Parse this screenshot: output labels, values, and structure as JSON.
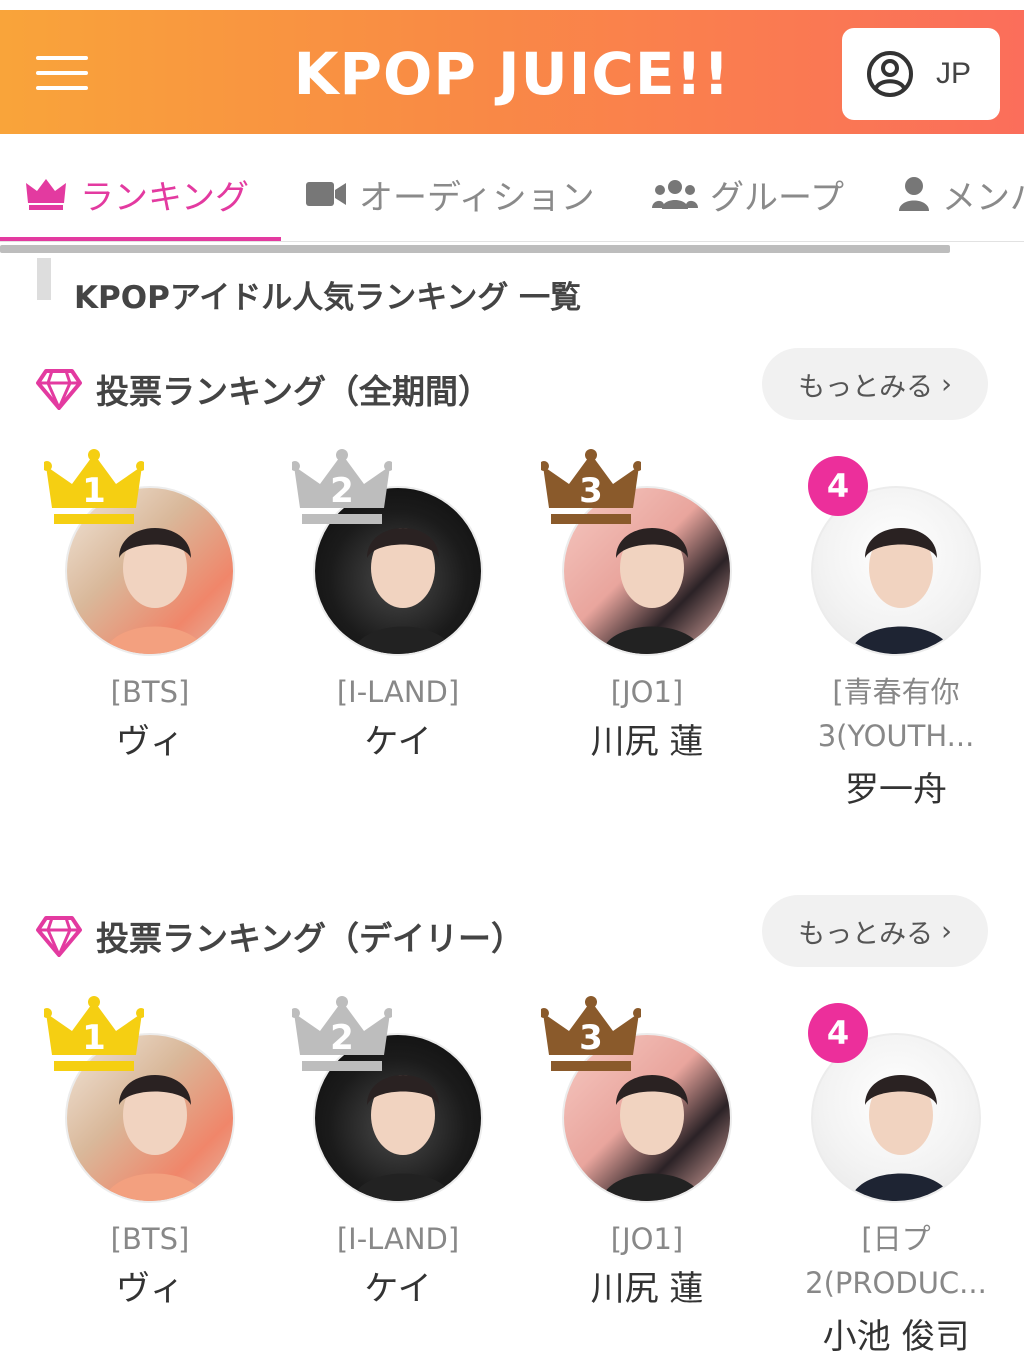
{
  "header": {
    "logo": "KPOP JUICE!!",
    "lang": "JP"
  },
  "tabs": [
    {
      "label": "ランキング",
      "icon": "crown-icon"
    },
    {
      "label": "オーディション",
      "icon": "video-camera-icon"
    },
    {
      "label": "グループ",
      "icon": "users-icon"
    },
    {
      "label": "メンバ",
      "icon": "user-icon"
    }
  ],
  "page_title": "KPOPアイドル人気ランキング 一覧",
  "sections": [
    {
      "title": "投票ランキング（全期間）",
      "more": "もっとみる",
      "items": [
        {
          "rank": "1",
          "group": "[BTS]",
          "name": "ヴィ"
        },
        {
          "rank": "2",
          "group": "[I-LAND]",
          "name": "ケイ"
        },
        {
          "rank": "3",
          "group": "[JO1]",
          "name": "川尻 蓮"
        },
        {
          "rank": "4",
          "group": "[青春有你",
          "group2": "3(YOUTH...",
          "name": "罗一舟"
        }
      ]
    },
    {
      "title": "投票ランキング（デイリー）",
      "more": "もっとみる",
      "items": [
        {
          "rank": "1",
          "group": "[BTS]",
          "name": "ヴィ"
        },
        {
          "rank": "2",
          "group": "[I-LAND]",
          "name": "ケイ"
        },
        {
          "rank": "3",
          "group": "[JO1]",
          "name": "川尻 蓮"
        },
        {
          "rank": "4",
          "group": "[日プ",
          "group2": "2(PRODUC...",
          "name": "小池 俊司"
        }
      ]
    }
  ],
  "colors": {
    "accent": "#e33aa0",
    "gold": "#f5cf12",
    "silver": "#bdbdbd",
    "bronze": "#8a5a2b",
    "badge": "#ec2f9b"
  }
}
